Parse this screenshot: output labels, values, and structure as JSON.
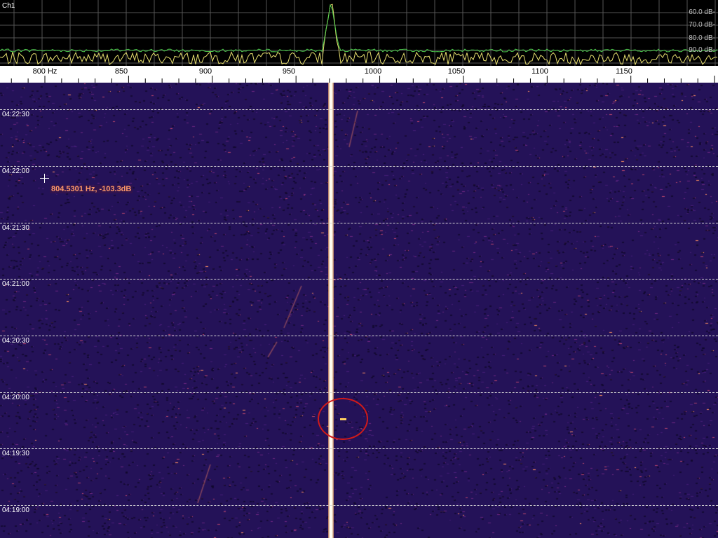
{
  "spectrum": {
    "channel_label": "Ch1",
    "db_labels": [
      "60.0 dB-",
      "70.0 dB-",
      "80.0 dB-",
      "90.0 dB-"
    ],
    "trace_colors": {
      "average": "#4ed04e",
      "instant": "#e8e070"
    }
  },
  "frequency_scale": {
    "unit": "Hz",
    "labels": [
      "800  Hz",
      "850",
      "900",
      "950",
      "1000",
      "1050",
      "1100",
      "1150"
    ]
  },
  "waterfall": {
    "time_labels": [
      "04:22:30",
      "04:22:00",
      "04:21:30",
      "04:21:00",
      "04:20:30",
      "04:20:00",
      "04:19:30",
      "04:19:00"
    ],
    "cursor_readout": "804.5301 Hz, -103.3dB",
    "colors": {
      "background": "#241258",
      "noise_hot": "#ff9060",
      "carrier": "#ffffff",
      "circle": "#d01a1a"
    }
  }
}
